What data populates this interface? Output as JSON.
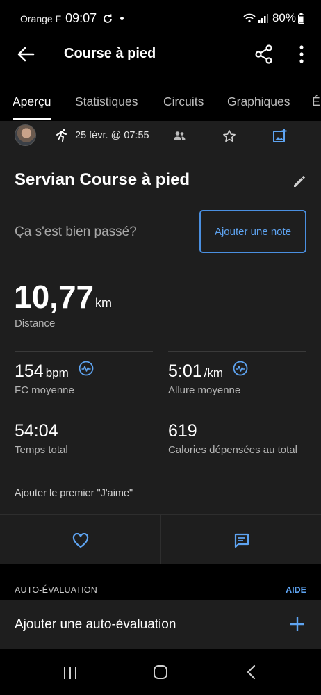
{
  "status_bar": {
    "carrier": "Orange F",
    "time": "09:07",
    "battery": "80%"
  },
  "app_bar": {
    "title": "Course à pied",
    "icons": [
      "arrow-back-icon",
      "share-icon",
      "more-vert-icon"
    ]
  },
  "tabs": [
    {
      "label": "Aperçu",
      "active": true
    },
    {
      "label": "Statistiques",
      "active": false
    },
    {
      "label": "Circuits",
      "active": false
    },
    {
      "label": "Graphiques",
      "active": false
    },
    {
      "label": "É",
      "active": false
    }
  ],
  "activity": {
    "date": "25 févr. @ 07:55",
    "title": "Servian Course à pied",
    "feel_prompt": "Ça s'est bien passé?",
    "add_note_label": "Ajouter une note"
  },
  "distance": {
    "value": "10,77",
    "unit": "km",
    "label": "Distance"
  },
  "metrics": {
    "hr": {
      "value": "154",
      "unit": "bpm",
      "label": "FC moyenne"
    },
    "pace": {
      "value": "5:01",
      "unit": "/km",
      "label": "Allure moyenne"
    },
    "time": {
      "value": "54:04",
      "label": "Temps total"
    },
    "calories": {
      "value": "619",
      "label": "Calories dépensées au total"
    }
  },
  "social": {
    "likes_prompt": "Ajouter le premier \"J'aime\""
  },
  "self_evaluation": {
    "section_title": "AUTO-ÉVALUATION",
    "help_label": "AIDE",
    "add_label": "Ajouter une auto-évaluation"
  },
  "colors": {
    "accent": "#5ea4f2",
    "background": "#000000",
    "card": "#1e1e1e"
  }
}
